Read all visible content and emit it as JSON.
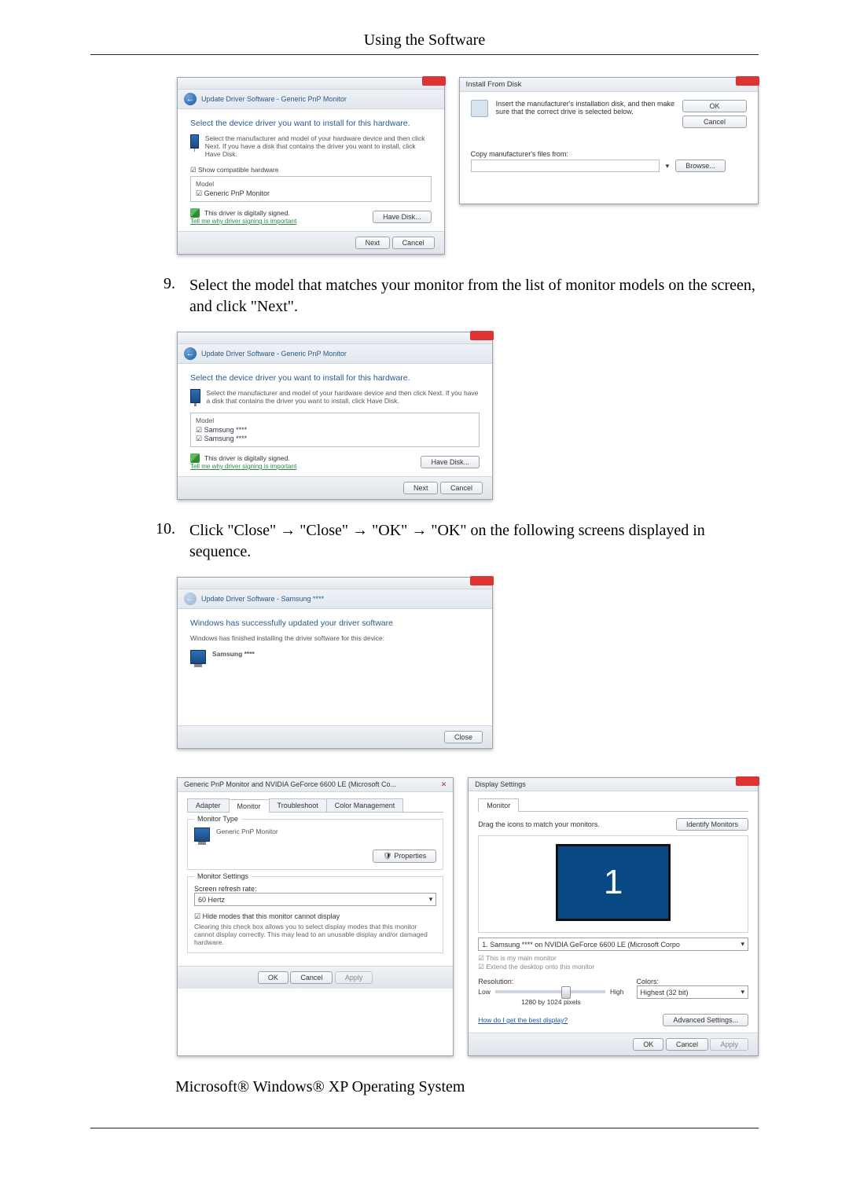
{
  "pageHeader": "Using the Software",
  "win1": {
    "breadcrumb": "Update Driver Software - Generic PnP Monitor",
    "heading": "Select the device driver you want to install for this hardware.",
    "hint": "Select the manufacturer and model of your hardware device and then click Next. If you have a disk that contains the driver you want to install, click Have Disk.",
    "showCompat": "Show compatible hardware",
    "modelHdr": "Model",
    "model": "Generic PnP Monitor",
    "signed": "This driver is digitally signed.",
    "tellWhy": "Tell me why driver signing is important",
    "haveDisk": "Have Disk...",
    "next": "Next",
    "cancel": "Cancel"
  },
  "ifd": {
    "title": "Install From Disk",
    "msg": "Insert the manufacturer's installation disk, and then make sure that the correct drive is selected below.",
    "ok": "OK",
    "cancel": "Cancel",
    "copyLabel": "Copy manufacturer's files from:",
    "browse": "Browse..."
  },
  "step9no": "9.",
  "step9text": "Select the model that matches your monitor from the list of monitor models on the screen, and click \"Next\".",
  "win2": {
    "breadcrumb": "Update Driver Software - Generic PnP Monitor",
    "heading": "Select the device driver you want to install for this hardware.",
    "hint": "Select the manufacturer and model of your hardware device and then click Next. If you have a disk that contains the driver you want to install, click Have Disk.",
    "modelHdr": "Model",
    "m1": "Samsung ****",
    "m2": "Samsung ****",
    "signed": "This driver is digitally signed.",
    "tellWhy": "Tell me why driver signing is important",
    "haveDisk": "Have Disk...",
    "next": "Next",
    "cancel": "Cancel"
  },
  "step10no": "10.",
  "step10text": "Click \"Close\" → \"Close\" → \"OK\" → \"OK\" on the following screens displayed in sequence.",
  "win3": {
    "breadcrumb": "Update Driver Software - Samsung ****",
    "heading": "Windows has successfully updated your driver software",
    "sub": "Windows has finished installing the driver software for this device:",
    "model": "Samsung ****",
    "close": "Close"
  },
  "props": {
    "title": "Generic PnP Monitor and NVIDIA GeForce 6600 LE (Microsoft Co...",
    "tabAdapter": "Adapter",
    "tabMonitor": "Monitor",
    "tabTrouble": "Troubleshoot",
    "tabColor": "Color Management",
    "monType": "Monitor Type",
    "monName": "Generic PnP Monitor",
    "propsBtn": "Properties",
    "monSettings": "Monitor Settings",
    "refreshLbl": "Screen refresh rate:",
    "refreshVal": "60 Hertz",
    "hideModes": "Hide modes that this monitor cannot display",
    "hideDesc": "Clearing this check box allows you to select display modes that this monitor cannot display correctly. This may lead to an unusable display and/or damaged hardware.",
    "ok": "OK",
    "cancel": "Cancel",
    "apply": "Apply"
  },
  "disp": {
    "title": "Display Settings",
    "tabMonitor": "Monitor",
    "dragText": "Drag the icons to match your monitors.",
    "identify": "Identify Monitors",
    "bigNum": "1",
    "selMon": "1. Samsung **** on NVIDIA GeForce 6600 LE (Microsoft Corpo",
    "chkMain": "This is my main monitor",
    "chkExtend": "Extend the desktop onto this monitor",
    "resLbl": "Resolution:",
    "low": "Low",
    "high": "High",
    "resVal": "1280 by 1024 pixels",
    "colorsLbl": "Colors:",
    "colorsVal": "Highest (32 bit)",
    "bestLink": "How do I get the best display?",
    "advBtn": "Advanced Settings...",
    "ok": "OK",
    "cancel": "Cancel",
    "apply": "Apply"
  },
  "footerLine": "Microsoft® Windows® XP Operating System"
}
